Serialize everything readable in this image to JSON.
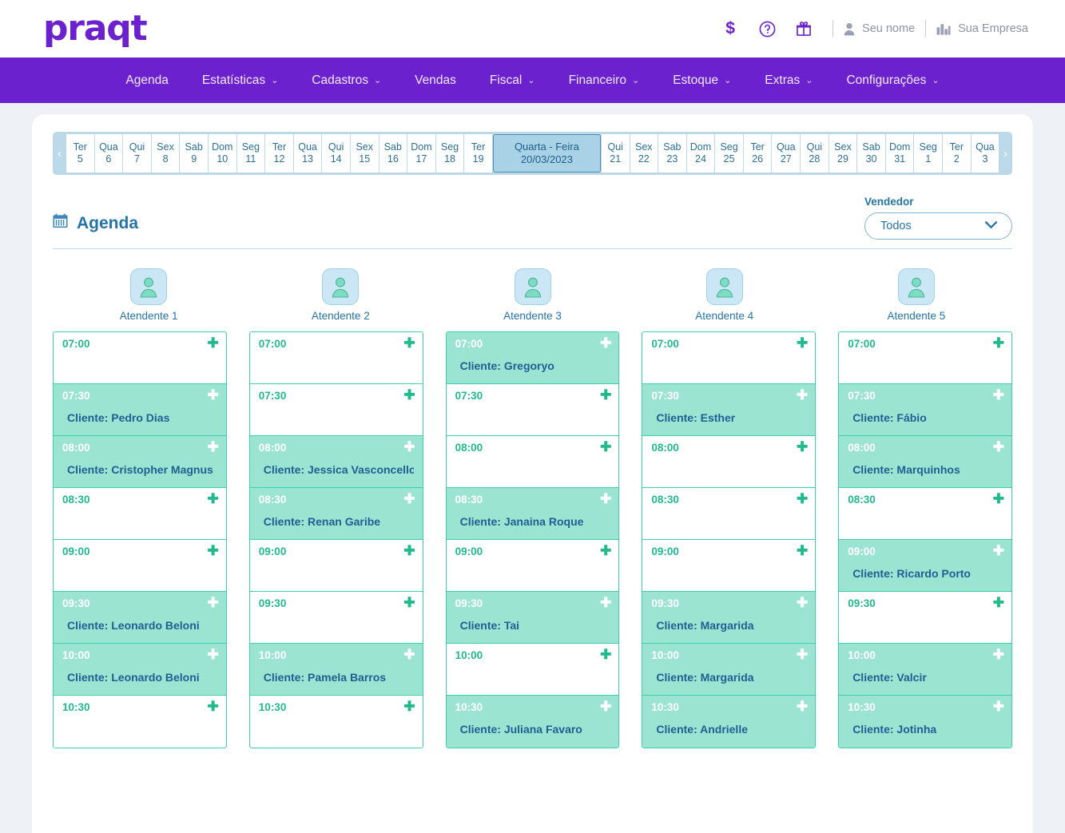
{
  "header": {
    "logo": "praqt",
    "money_icon": "$",
    "help_icon": "?",
    "gift_icon": "gift-icon",
    "user_name": "Seu nome",
    "company_name": "Sua Empresa"
  },
  "nav": {
    "items": [
      {
        "label": "Agenda",
        "has_caret": false
      },
      {
        "label": "Estatísticas",
        "has_caret": true
      },
      {
        "label": "Cadastros",
        "has_caret": true
      },
      {
        "label": "Vendas",
        "has_caret": false
      },
      {
        "label": "Fiscal",
        "has_caret": true
      },
      {
        "label": "Financeiro",
        "has_caret": true
      },
      {
        "label": "Estoque",
        "has_caret": true
      },
      {
        "label": "Extras",
        "has_caret": true
      },
      {
        "label": "Configurações",
        "has_caret": true
      }
    ]
  },
  "datestrip": {
    "prev_arrow": "‹",
    "next_arrow": "›",
    "days": [
      {
        "dow": "Ter",
        "num": "5"
      },
      {
        "dow": "Qua",
        "num": "6"
      },
      {
        "dow": "Qui",
        "num": "7"
      },
      {
        "dow": "Sex",
        "num": "8"
      },
      {
        "dow": "Sab",
        "num": "9"
      },
      {
        "dow": "Dom",
        "num": "10"
      },
      {
        "dow": "Seg",
        "num": "11"
      },
      {
        "dow": "Ter",
        "num": "12"
      },
      {
        "dow": "Qua",
        "num": "13"
      },
      {
        "dow": "Qui",
        "num": "14"
      },
      {
        "dow": "Sex",
        "num": "15"
      },
      {
        "dow": "Sab",
        "num": "16"
      },
      {
        "dow": "Dom",
        "num": "17"
      },
      {
        "dow": "Seg",
        "num": "18"
      },
      {
        "dow": "Ter",
        "num": "19"
      },
      {
        "dow": "Quarta - Feira",
        "num": "20/03/2023",
        "selected": true
      },
      {
        "dow": "Qui",
        "num": "21"
      },
      {
        "dow": "Sex",
        "num": "22"
      },
      {
        "dow": "Sab",
        "num": "23"
      },
      {
        "dow": "Dom",
        "num": "24"
      },
      {
        "dow": "Seg",
        "num": "25"
      },
      {
        "dow": "Ter",
        "num": "26"
      },
      {
        "dow": "Qua",
        "num": "27"
      },
      {
        "dow": "Qui",
        "num": "28"
      },
      {
        "dow": "Sex",
        "num": "29"
      },
      {
        "dow": "Sab",
        "num": "30"
      },
      {
        "dow": "Dom",
        "num": "31"
      },
      {
        "dow": "Seg",
        "num": "1"
      },
      {
        "dow": "Ter",
        "num": "2"
      },
      {
        "dow": "Qua",
        "num": "3"
      }
    ]
  },
  "agenda": {
    "title": "Agenda",
    "calendar_icon": "calendar-icon",
    "vendor_label": "Vendedor",
    "vendor_value": "Todos",
    "plus_glyph": "✚"
  },
  "attendants": [
    {
      "name": "Atendente 1"
    },
    {
      "name": "Atendente 2"
    },
    {
      "name": "Atendente 3"
    },
    {
      "name": "Atendente 4"
    },
    {
      "name": "Atendente 5"
    }
  ],
  "columns": [
    {
      "attendant": "Atendente 1",
      "slots": [
        {
          "time": "07:00",
          "client": "",
          "booked": false
        },
        {
          "time": "07:30",
          "client": "Cliente: Pedro Dias",
          "booked": true
        },
        {
          "time": "08:00",
          "client": "Cliente: Cristopher Magnus",
          "booked": true
        },
        {
          "time": "08:30",
          "client": "",
          "booked": false
        },
        {
          "time": "09:00",
          "client": "",
          "booked": false
        },
        {
          "time": "09:30",
          "client": "Cliente: Leonardo Beloni",
          "booked": true
        },
        {
          "time": "10:00",
          "client": "Cliente: Leonardo Beloni",
          "booked": true
        },
        {
          "time": "10:30",
          "client": "",
          "booked": false
        }
      ]
    },
    {
      "attendant": "Atendente 2",
      "slots": [
        {
          "time": "07:00",
          "client": "",
          "booked": false
        },
        {
          "time": "07:30",
          "client": "",
          "booked": false
        },
        {
          "time": "08:00",
          "client": "Cliente: Jessica Vasconcellos",
          "booked": true
        },
        {
          "time": "08:30",
          "client": "Cliente: Renan Garibe",
          "booked": true
        },
        {
          "time": "09:00",
          "client": "",
          "booked": false
        },
        {
          "time": "09:30",
          "client": "",
          "booked": false
        },
        {
          "time": "10:00",
          "client": "Cliente: Pamela Barros",
          "booked": true
        },
        {
          "time": "10:30",
          "client": "",
          "booked": false
        }
      ]
    },
    {
      "attendant": "Atendente 3",
      "slots": [
        {
          "time": "07:00",
          "client": "Cliente: Gregoryo",
          "booked": true
        },
        {
          "time": "07:30",
          "client": "",
          "booked": false
        },
        {
          "time": "08:00",
          "client": "",
          "booked": false
        },
        {
          "time": "08:30",
          "client": "Cliente: Janaina Roque",
          "booked": true
        },
        {
          "time": "09:00",
          "client": "",
          "booked": false
        },
        {
          "time": "09:30",
          "client": "Cliente: Tai",
          "booked": true
        },
        {
          "time": "10:00",
          "client": "",
          "booked": false
        },
        {
          "time": "10:30",
          "client": "Cliente: Juliana Favaro",
          "booked": true
        }
      ]
    },
    {
      "attendant": "Atendente 4",
      "slots": [
        {
          "time": "07:00",
          "client": "",
          "booked": false
        },
        {
          "time": "07:30",
          "client": "Cliente: Esther",
          "booked": true
        },
        {
          "time": "08:00",
          "client": "",
          "booked": false
        },
        {
          "time": "08:30",
          "client": "",
          "booked": false
        },
        {
          "time": "09:00",
          "client": "",
          "booked": false
        },
        {
          "time": "09:30",
          "client": "Cliente: Margarida",
          "booked": true
        },
        {
          "time": "10:00",
          "client": "Cliente: Margarida",
          "booked": true
        },
        {
          "time": "10:30",
          "client": "Cliente: Andrielle",
          "booked": true
        }
      ]
    },
    {
      "attendant": "Atendente 5",
      "slots": [
        {
          "time": "07:00",
          "client": "",
          "booked": false
        },
        {
          "time": "07:30",
          "client": "Cliente: Fábio",
          "booked": true
        },
        {
          "time": "08:00",
          "client": "Cliente: Marquinhos",
          "booked": true
        },
        {
          "time": "08:30",
          "client": "",
          "booked": false
        },
        {
          "time": "09:00",
          "client": "Cliente: Ricardo Porto",
          "booked": true
        },
        {
          "time": "09:30",
          "client": "",
          "booked": false
        },
        {
          "time": "10:00",
          "client": "Cliente: Valcir",
          "booked": true
        },
        {
          "time": "10:30",
          "client": "Cliente: Jotinha",
          "booked": true
        }
      ]
    }
  ],
  "colors": {
    "brand_purple": "#6c21cf",
    "teal_border": "#3dd0ad",
    "teal_fill": "#9ce4d2",
    "blue_text": "#2574a9",
    "selected_day": "#a9d2e6",
    "page_bg": "#eef2f7"
  }
}
